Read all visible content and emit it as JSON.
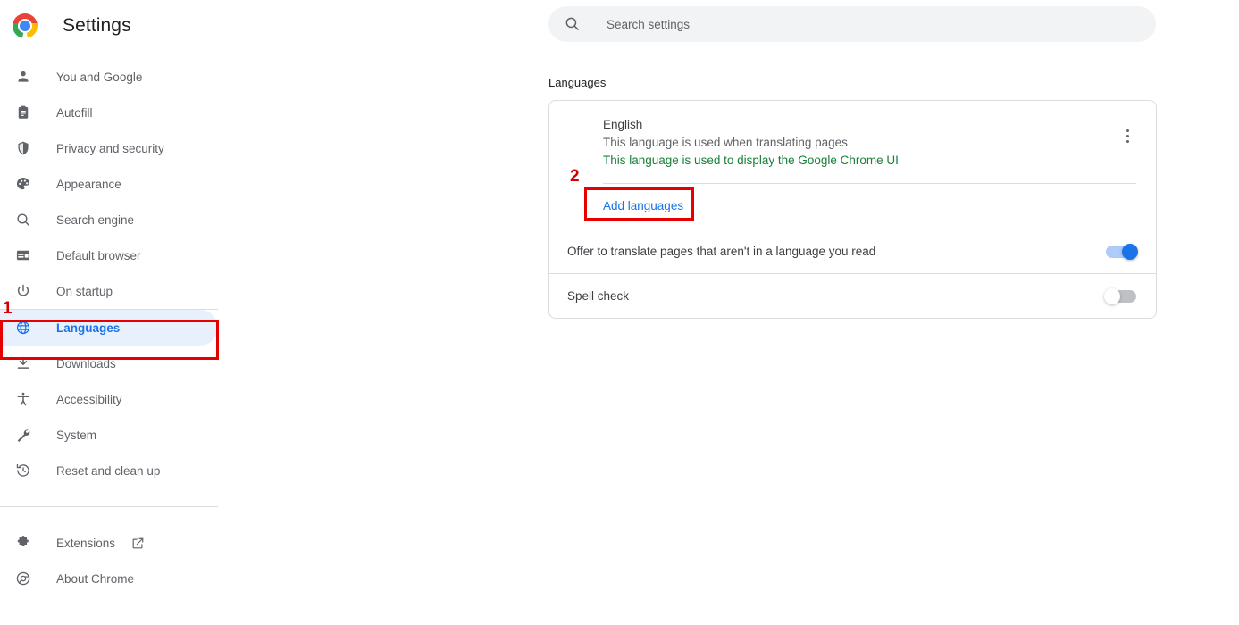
{
  "app": {
    "title": "Settings",
    "logo_icon": "chrome-logo-icon"
  },
  "search": {
    "placeholder": "Search settings",
    "value": "",
    "icon": "search-icon"
  },
  "sidebar": {
    "items": [
      {
        "label": "You and Google",
        "icon": "person-icon",
        "selected": false
      },
      {
        "label": "Autofill",
        "icon": "clipboard-icon",
        "selected": false
      },
      {
        "label": "Privacy and security",
        "icon": "shield-icon",
        "selected": false
      },
      {
        "label": "Appearance",
        "icon": "palette-icon",
        "selected": false
      },
      {
        "label": "Search engine",
        "icon": "magnifier-icon",
        "selected": false
      },
      {
        "label": "Default browser",
        "icon": "browser-window-icon",
        "selected": false
      },
      {
        "label": "On startup",
        "icon": "power-icon",
        "selected": false
      },
      {
        "label": "Languages",
        "icon": "globe-icon",
        "selected": true
      },
      {
        "label": "Downloads",
        "icon": "download-icon",
        "selected": false
      },
      {
        "label": "Accessibility",
        "icon": "accessibility-icon",
        "selected": false
      },
      {
        "label": "System",
        "icon": "wrench-icon",
        "selected": false
      },
      {
        "label": "Reset and clean up",
        "icon": "history-icon",
        "selected": false
      }
    ],
    "footer_items": [
      {
        "label": "Extensions",
        "icon": "puzzle-icon",
        "external": true,
        "external_icon": "external-link-icon"
      },
      {
        "label": "About Chrome",
        "icon": "chrome-outline-icon",
        "external": false
      }
    ],
    "selected_bg": "#e8f0fe",
    "selected_fg": "#1a73e8"
  },
  "main": {
    "section_title": "Languages",
    "language": {
      "name": "English",
      "translate_note": "This language is used when translating pages",
      "ui_note": "This language is used to display the Google Chrome UI",
      "ui_note_color": "#188038",
      "menu_icon": "more-vert-icon",
      "add_languages_label": "Add languages"
    },
    "settings": [
      {
        "label": "Offer to translate pages that aren't in a language you read",
        "state": "on"
      },
      {
        "label": "Spell check",
        "state": "off"
      }
    ]
  },
  "annotations": {
    "color": "#e60000",
    "marks": [
      {
        "number": "1",
        "target": "sidebar-item-languages"
      },
      {
        "number": "2",
        "target": "add-languages-button"
      }
    ]
  }
}
